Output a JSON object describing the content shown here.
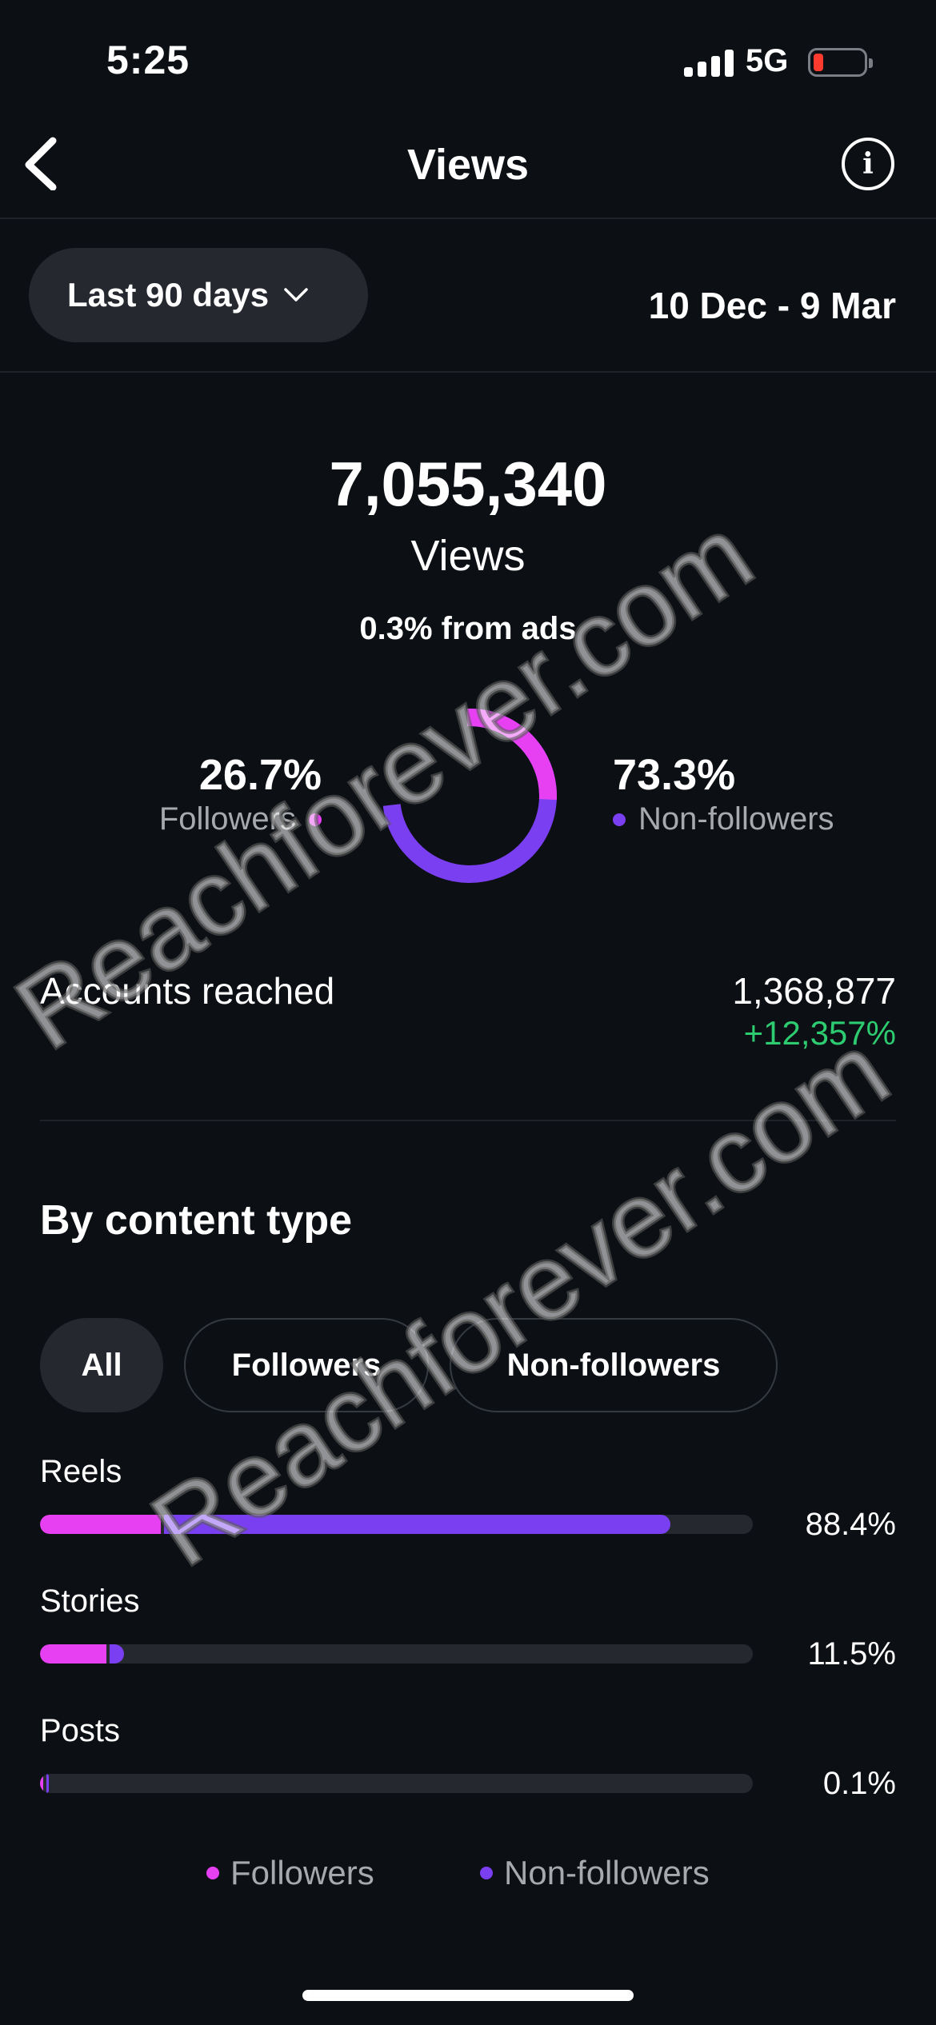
{
  "status_bar": {
    "time": "5:25",
    "network": "5G",
    "battery_color": "#ff3b30"
  },
  "nav": {
    "title": "Views",
    "back_icon": "chevron-left-icon",
    "info_icon": "info-icon"
  },
  "filter": {
    "range_label": "Last 90 days",
    "date_range": "10 Dec - 9 Mar"
  },
  "summary": {
    "total": "7,055,340",
    "label": "Views",
    "ads_note": "0.3% from ads",
    "followers_pct": "26.7%",
    "followers_label": "Followers",
    "non_followers_pct": "73.3%",
    "non_followers_label": "Non-followers",
    "followers_share": 0.267,
    "non_followers_share": 0.733
  },
  "reach": {
    "label": "Accounts reached",
    "value": "1,368,877",
    "change": "+12,357%"
  },
  "content_type": {
    "title": "By content type",
    "chips": [
      "All",
      "Followers",
      "Non-followers"
    ],
    "active_chip": "All",
    "rows": [
      {
        "label": "Reels",
        "value": "88.4%",
        "followers_fraction": 0.17,
        "non_followers_fraction": 0.71
      },
      {
        "label": "Stories",
        "value": "11.5%",
        "followers_fraction": 0.093,
        "non_followers_fraction": 0.02
      },
      {
        "label": "Posts",
        "value": "0.1%",
        "followers_fraction": 0.002,
        "non_followers_fraction": 0.001
      }
    ],
    "legend": [
      "Followers",
      "Non-followers"
    ]
  },
  "colors": {
    "followers": "#e640f2",
    "non_followers": "#7b3ff2",
    "positive": "#2ecc71",
    "background": "#0c0f14"
  },
  "watermark": "Reachforever.com"
}
